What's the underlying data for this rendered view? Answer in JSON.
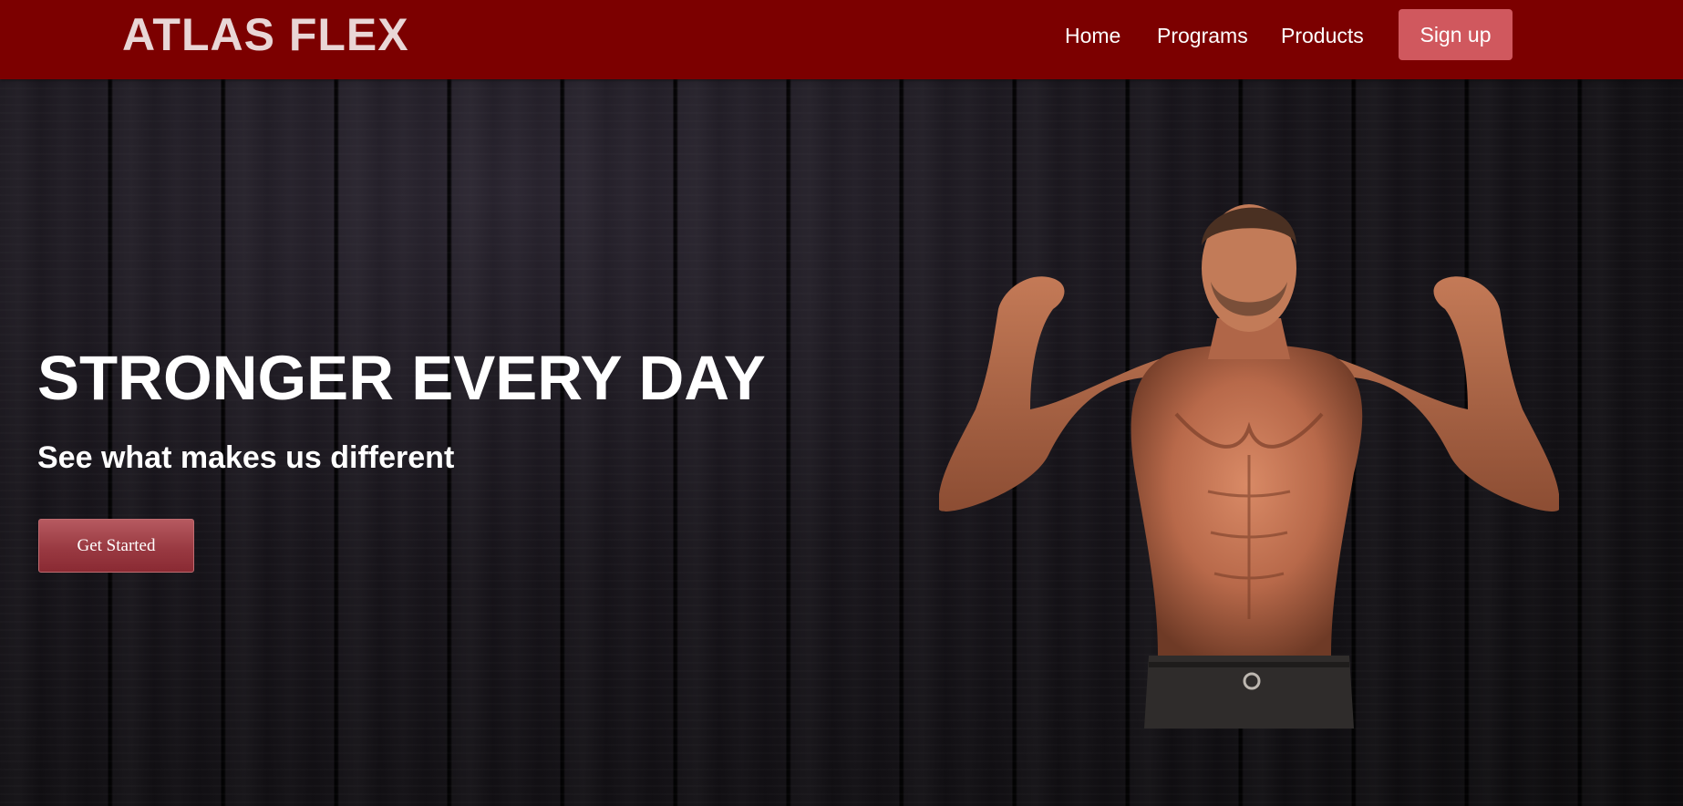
{
  "header": {
    "logo_text": "ATLAS FLEX",
    "nav": {
      "home": "Home",
      "programs": "Programs",
      "products": "Products",
      "signup": "Sign up"
    }
  },
  "hero": {
    "title": "STRONGER EVERY DAY",
    "subtitle": "See what makes us different",
    "cta_label": "Get Started"
  },
  "colors": {
    "nav_background": "#7c0000",
    "signup_button": "#d0585e",
    "cta_button": "#9a3a42",
    "hero_background": "#141216"
  }
}
